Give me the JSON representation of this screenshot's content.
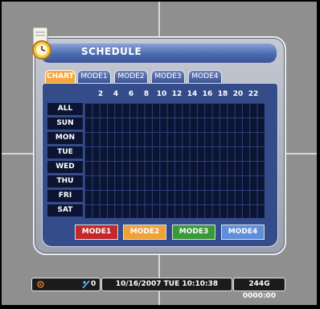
{
  "dialog": {
    "title": "SCHEDULE",
    "tabs": [
      {
        "label": "CHART",
        "active": true
      },
      {
        "label": "MODE1",
        "active": false
      },
      {
        "label": "MODE2",
        "active": false
      },
      {
        "label": "MODE3",
        "active": false
      },
      {
        "label": "MODE4",
        "active": false
      }
    ],
    "hours": [
      "2",
      "4",
      "6",
      "8",
      "10",
      "12",
      "14",
      "16",
      "18",
      "20",
      "22"
    ],
    "days": [
      "ALL",
      "SUN",
      "MON",
      "TUE",
      "WED",
      "THU",
      "FRI",
      "SAT"
    ],
    "mode_buttons": [
      {
        "label": "MODE1",
        "color": "#c2292d"
      },
      {
        "label": "MODE2",
        "color": "#f0a23a"
      },
      {
        "label": "MODE3",
        "color": "#3a9a3a"
      },
      {
        "label": "MODE4",
        "color": "#5f8fd8"
      }
    ]
  },
  "status_bar": {
    "record_icon": "record-icon",
    "network_icon": "network-icon",
    "network_count": "0",
    "datetime": "10/16/2007 TUE 10:10:38",
    "disk": "244G  0000:00"
  }
}
